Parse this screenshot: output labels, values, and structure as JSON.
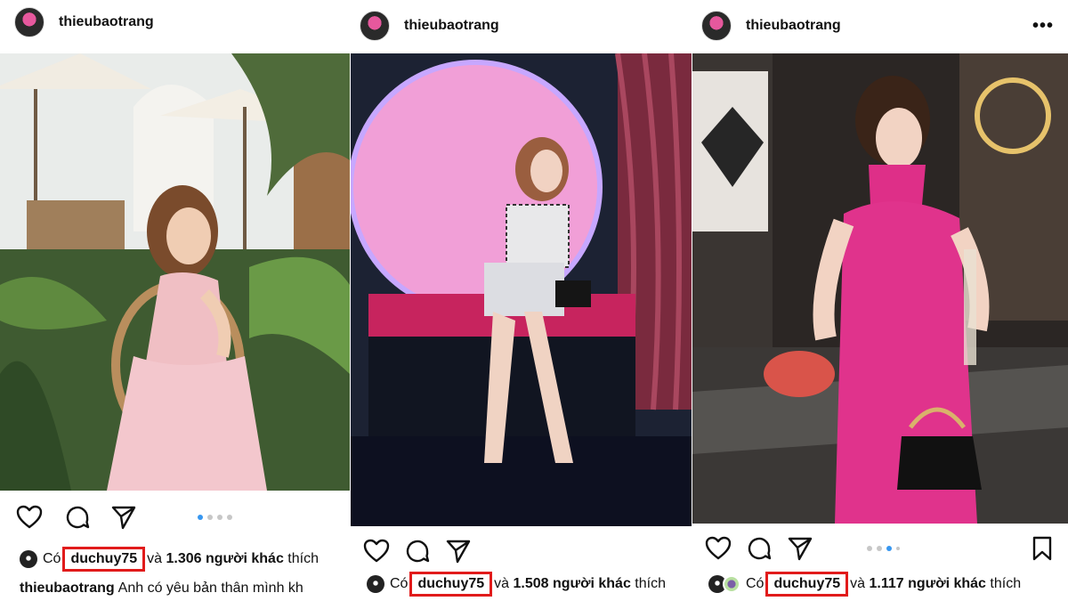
{
  "posts": [
    {
      "username": "thieubaotrang",
      "likes_prefix": "Có",
      "liker": "duchuy75",
      "likes_suffix": "và 1.306 người khác thích",
      "caption_user": "thieubaotrang",
      "caption_text": "Anh có yêu bản thân mình kh",
      "carousel_index": 1
    },
    {
      "username": "thieubaotrang",
      "likes_prefix": "Có",
      "liker": "duchuy75",
      "likes_suffix": "và 1.508 người khác thích"
    },
    {
      "username": "thieubaotrang",
      "more": "•••",
      "likes_prefix": "Có",
      "liker": "duchuy75",
      "likes_suffix": "và 1.117 người khác thích",
      "carousel_index": 3
    }
  ],
  "colors": {
    "highlight_box": "#e11b1b",
    "dot_active": "#3797f0",
    "dot_inactive": "#c7c7c7"
  },
  "icons": [
    "heart-icon",
    "comment-icon",
    "share-icon",
    "bookmark-icon",
    "more-icon"
  ]
}
